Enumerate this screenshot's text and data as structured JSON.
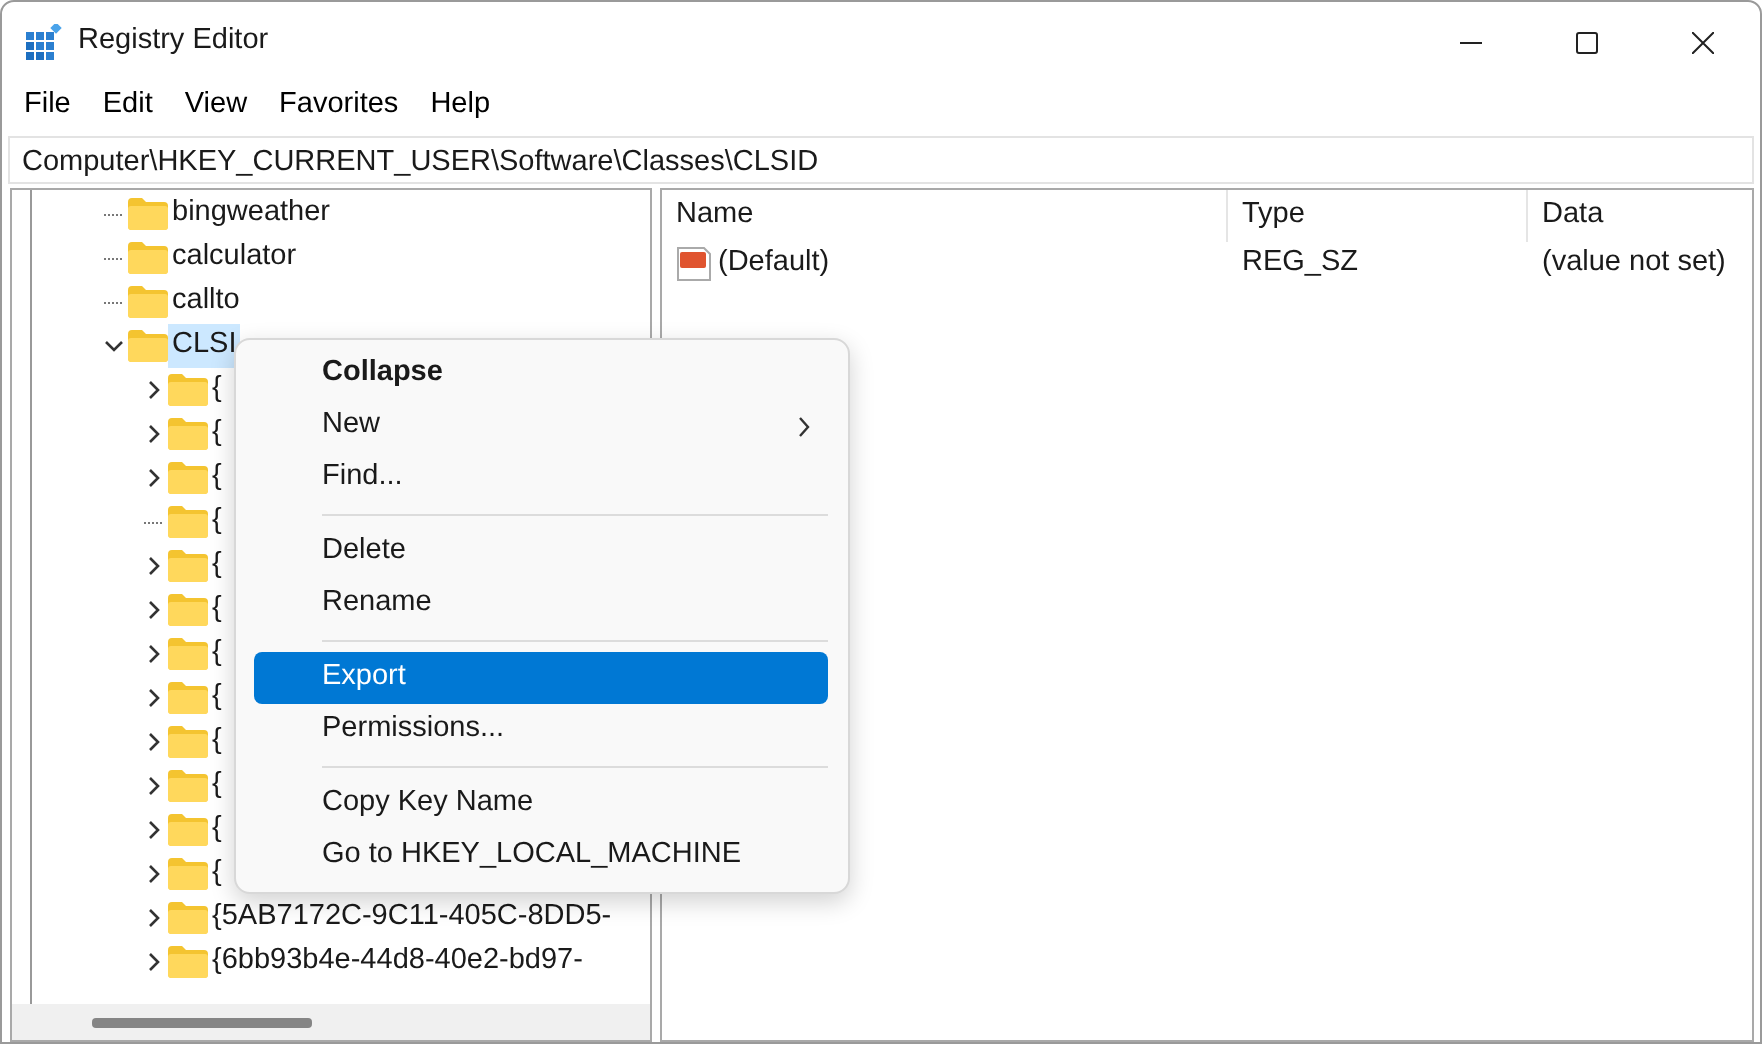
{
  "window": {
    "title": "Registry Editor"
  },
  "menu_bar": [
    {
      "label": "File"
    },
    {
      "label": "Edit"
    },
    {
      "label": "View"
    },
    {
      "label": "Favorites"
    },
    {
      "label": "Help"
    }
  ],
  "address": "Computer\\HKEY_CURRENT_USER\\Software\\Classes\\CLSID",
  "tree": [
    {
      "kind": "leaf",
      "label": "bingweather",
      "selected": false
    },
    {
      "kind": "leaf",
      "label": "calculator",
      "selected": false
    },
    {
      "kind": "leaf",
      "label": "callto",
      "selected": false
    },
    {
      "kind": "branch",
      "label": "CLSI",
      "expanded": true,
      "selected": true,
      "children": [
        {
          "kind": "branch",
          "label": "{",
          "expanded": false,
          "selected": false
        },
        {
          "kind": "branch",
          "label": "{",
          "expanded": false,
          "selected": false
        },
        {
          "kind": "branch",
          "label": "{",
          "expanded": false,
          "selected": false
        },
        {
          "kind": "leaf",
          "label": "{",
          "selected": false
        },
        {
          "kind": "branch",
          "label": "{",
          "expanded": false,
          "selected": false
        },
        {
          "kind": "branch",
          "label": "{",
          "expanded": false,
          "selected": false
        },
        {
          "kind": "branch",
          "label": "{",
          "expanded": false,
          "selected": false
        },
        {
          "kind": "branch",
          "label": "{",
          "expanded": false,
          "selected": false
        },
        {
          "kind": "branch",
          "label": "{",
          "expanded": false,
          "selected": false
        },
        {
          "kind": "branch",
          "label": "{",
          "expanded": false,
          "selected": false
        },
        {
          "kind": "branch",
          "label": "{",
          "expanded": false,
          "selected": false
        },
        {
          "kind": "branch",
          "label": "{",
          "expanded": false,
          "selected": false
        },
        {
          "kind": "branch",
          "label": "{5AB7172C-9C11-405C-8DD5-",
          "expanded": false,
          "selected": false
        },
        {
          "kind": "branch",
          "label": "{6bb93b4e-44d8-40e2-bd97-",
          "expanded": false,
          "selected": false
        }
      ]
    }
  ],
  "values": {
    "columns": [
      "Name",
      "Type",
      "Data"
    ],
    "rows": [
      {
        "name": "(Default)",
        "type": "REG_SZ",
        "data": "(value not set)",
        "selected": false
      }
    ]
  },
  "context_menu": [
    {
      "kind": "item",
      "label": "Collapse",
      "default": true,
      "submenu": false,
      "selected": false
    },
    {
      "kind": "item",
      "label": "New",
      "default": false,
      "submenu": true,
      "selected": false
    },
    {
      "kind": "item",
      "label": "Find...",
      "default": false,
      "submenu": false,
      "selected": false
    },
    {
      "kind": "separator"
    },
    {
      "kind": "item",
      "label": "Delete",
      "default": false,
      "submenu": false,
      "selected": false
    },
    {
      "kind": "item",
      "label": "Rename",
      "default": false,
      "submenu": false,
      "selected": false
    },
    {
      "kind": "separator"
    },
    {
      "kind": "item",
      "label": "Export",
      "default": false,
      "submenu": false,
      "selected": true
    },
    {
      "kind": "item",
      "label": "Permissions...",
      "default": false,
      "submenu": false,
      "selected": false
    },
    {
      "kind": "separator"
    },
    {
      "kind": "item",
      "label": "Copy Key Name",
      "default": false,
      "submenu": false,
      "selected": false
    },
    {
      "kind": "item",
      "label": "Go to HKEY_LOCAL_MACHINE",
      "default": false,
      "submenu": false,
      "selected": false
    }
  ]
}
